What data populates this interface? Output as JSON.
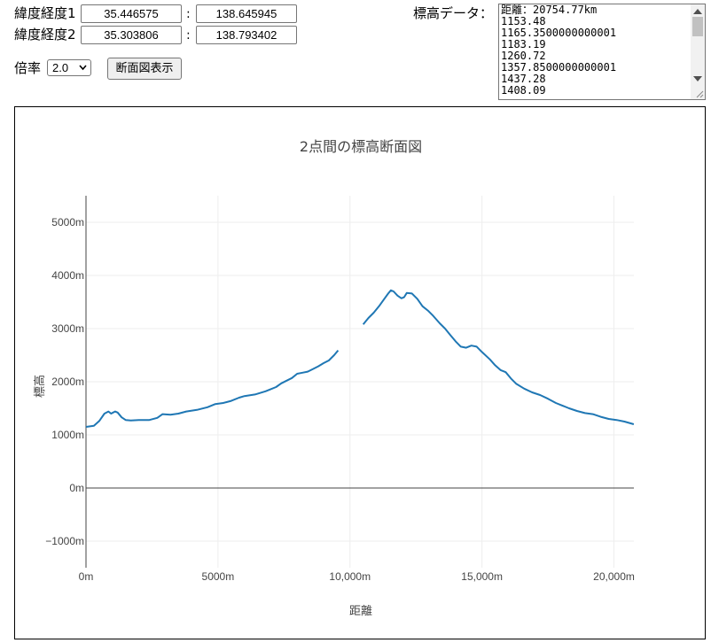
{
  "form": {
    "point1_label": "緯度経度1",
    "point1_lat": "35.446575",
    "point1_lng": "138.645945",
    "point2_label": "緯度経度2",
    "point2_lat": "35.303806",
    "point2_lng": "138.793402",
    "separator": ":",
    "scale_label": "倍率",
    "scale_value": "2.0",
    "show_button": "断面図表示"
  },
  "elevation_data": {
    "label": "標高データ：",
    "lines": [
      "距離：20754.77km",
      "1153.48",
      "1165.3500000000001",
      "1183.19",
      "1260.72",
      "1357.8500000000001",
      "1437.28",
      "1408.09"
    ]
  },
  "chart_data": {
    "type": "line",
    "title": "2点間の標高断面図",
    "xlabel": "距離",
    "ylabel": "標高",
    "xlim": [
      0,
      20754.77
    ],
    "ylim": [
      -1500,
      5500
    ],
    "x_ticks": [
      0,
      5000,
      10000,
      15000,
      20000
    ],
    "x_tick_labels": [
      "0m",
      "5000m",
      "10,000m",
      "15,000m",
      "20,000m"
    ],
    "y_ticks": [
      -1000,
      0,
      1000,
      2000,
      3000,
      4000,
      5000
    ],
    "y_tick_labels": [
      "−1000m",
      "0m",
      "1000m",
      "2000m",
      "3000m",
      "4000m",
      "5000m"
    ],
    "grid": true,
    "line_color": "#1f77b4",
    "series": [
      {
        "segments": [
          [
            [
              0,
              1150
            ],
            [
              300,
              1170
            ],
            [
              500,
              1260
            ],
            [
              700,
              1400
            ],
            [
              850,
              1440
            ],
            [
              950,
              1400
            ],
            [
              1100,
              1440
            ],
            [
              1200,
              1420
            ],
            [
              1350,
              1330
            ],
            [
              1500,
              1280
            ],
            [
              1700,
              1270
            ],
            [
              2000,
              1280
            ],
            [
              2400,
              1280
            ],
            [
              2700,
              1320
            ],
            [
              2900,
              1390
            ],
            [
              3200,
              1380
            ],
            [
              3500,
              1400
            ],
            [
              3800,
              1440
            ],
            [
              4200,
              1470
            ],
            [
              4600,
              1520
            ],
            [
              4900,
              1580
            ],
            [
              5200,
              1600
            ],
            [
              5500,
              1640
            ],
            [
              5800,
              1700
            ],
            [
              6000,
              1730
            ],
            [
              6400,
              1760
            ],
            [
              6800,
              1820
            ],
            [
              7000,
              1860
            ],
            [
              7200,
              1900
            ],
            [
              7400,
              1970
            ],
            [
              7600,
              2020
            ],
            [
              7800,
              2070
            ],
            [
              8000,
              2150
            ],
            [
              8200,
              2170
            ],
            [
              8400,
              2190
            ],
            [
              8600,
              2240
            ],
            [
              8800,
              2290
            ],
            [
              9000,
              2350
            ],
            [
              9200,
              2400
            ],
            [
              9400,
              2500
            ],
            [
              9550,
              2590
            ]
          ],
          [
            [
              10500,
              3080
            ],
            [
              10700,
              3200
            ],
            [
              10900,
              3300
            ],
            [
              11100,
              3420
            ],
            [
              11300,
              3560
            ],
            [
              11450,
              3660
            ],
            [
              11550,
              3720
            ],
            [
              11650,
              3700
            ],
            [
              11800,
              3620
            ],
            [
              11950,
              3570
            ],
            [
              12050,
              3590
            ],
            [
              12150,
              3670
            ],
            [
              12350,
              3660
            ],
            [
              12550,
              3560
            ],
            [
              12750,
              3420
            ],
            [
              12950,
              3340
            ],
            [
              13150,
              3240
            ],
            [
              13400,
              3100
            ],
            [
              13600,
              3000
            ],
            [
              13800,
              2880
            ],
            [
              14000,
              2760
            ],
            [
              14200,
              2660
            ],
            [
              14400,
              2640
            ],
            [
              14600,
              2680
            ],
            [
              14800,
              2660
            ],
            [
              15000,
              2560
            ],
            [
              15300,
              2420
            ],
            [
              15500,
              2310
            ],
            [
              15700,
              2220
            ],
            [
              15900,
              2180
            ],
            [
              16100,
              2060
            ],
            [
              16300,
              1960
            ],
            [
              16600,
              1870
            ],
            [
              16900,
              1800
            ],
            [
              17200,
              1750
            ],
            [
              17500,
              1680
            ],
            [
              17800,
              1600
            ],
            [
              18000,
              1560
            ],
            [
              18300,
              1500
            ],
            [
              18600,
              1450
            ],
            [
              18900,
              1410
            ],
            [
              19200,
              1390
            ],
            [
              19500,
              1340
            ],
            [
              19800,
              1300
            ],
            [
              20100,
              1280
            ],
            [
              20400,
              1250
            ],
            [
              20750,
              1200
            ]
          ]
        ]
      }
    ]
  }
}
